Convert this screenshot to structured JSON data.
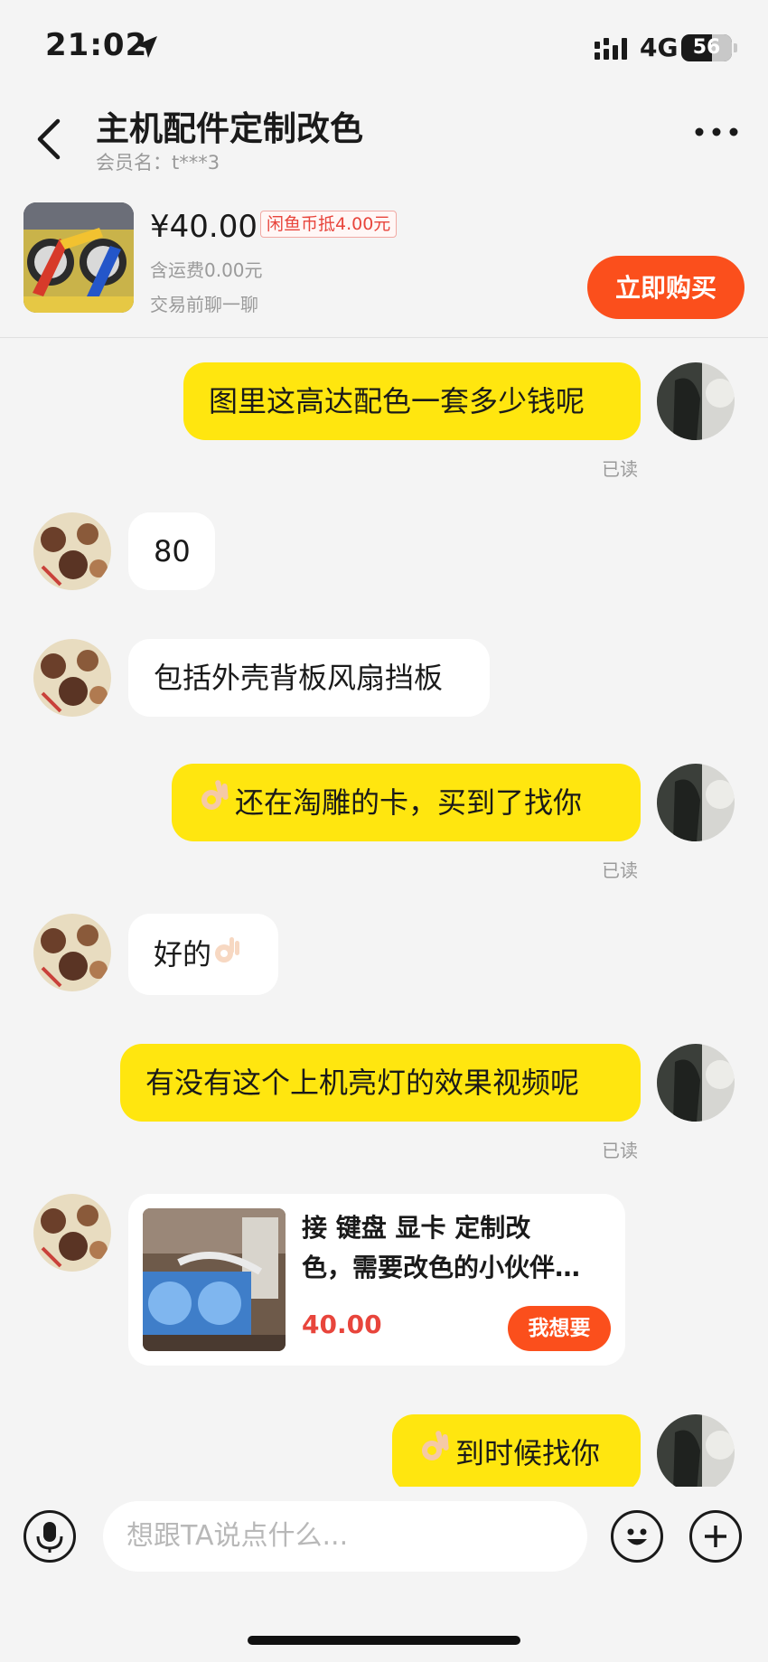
{
  "status": {
    "time": "21:02",
    "network": "4G",
    "battery": "56"
  },
  "header": {
    "title": "主机配件定制改色",
    "member": "会员名：t***3"
  },
  "product": {
    "price": "¥40.00",
    "coin_badge": "闲鱼币抵4.00元",
    "shipping": "含运费0.00元",
    "pre_chat": "交易前聊一聊",
    "buy_label": "立即购买"
  },
  "messages": [
    {
      "from": "me",
      "text": "图里这高达配色一套多少钱呢",
      "read": "已读"
    },
    {
      "from": "other",
      "text": "80"
    },
    {
      "from": "other",
      "text": "包括外壳背板风扇挡板"
    },
    {
      "from": "me",
      "text": "还在淘雕的卡，买到了找你",
      "read": "已读"
    },
    {
      "from": "other",
      "text": "好的"
    },
    {
      "from": "me",
      "text": "有没有这个上机亮灯的效果视频呢",
      "read": "已读"
    },
    {
      "from": "other",
      "type": "card",
      "title_line1": "接 键盘 显卡 定制改",
      "title_line2": "色，需要改色的小伙伴…",
      "price": "40.00",
      "button": "我想要"
    },
    {
      "from": "me",
      "text": "到时候找你"
    }
  ],
  "input": {
    "placeholder": "想跟TA说点什么..."
  }
}
